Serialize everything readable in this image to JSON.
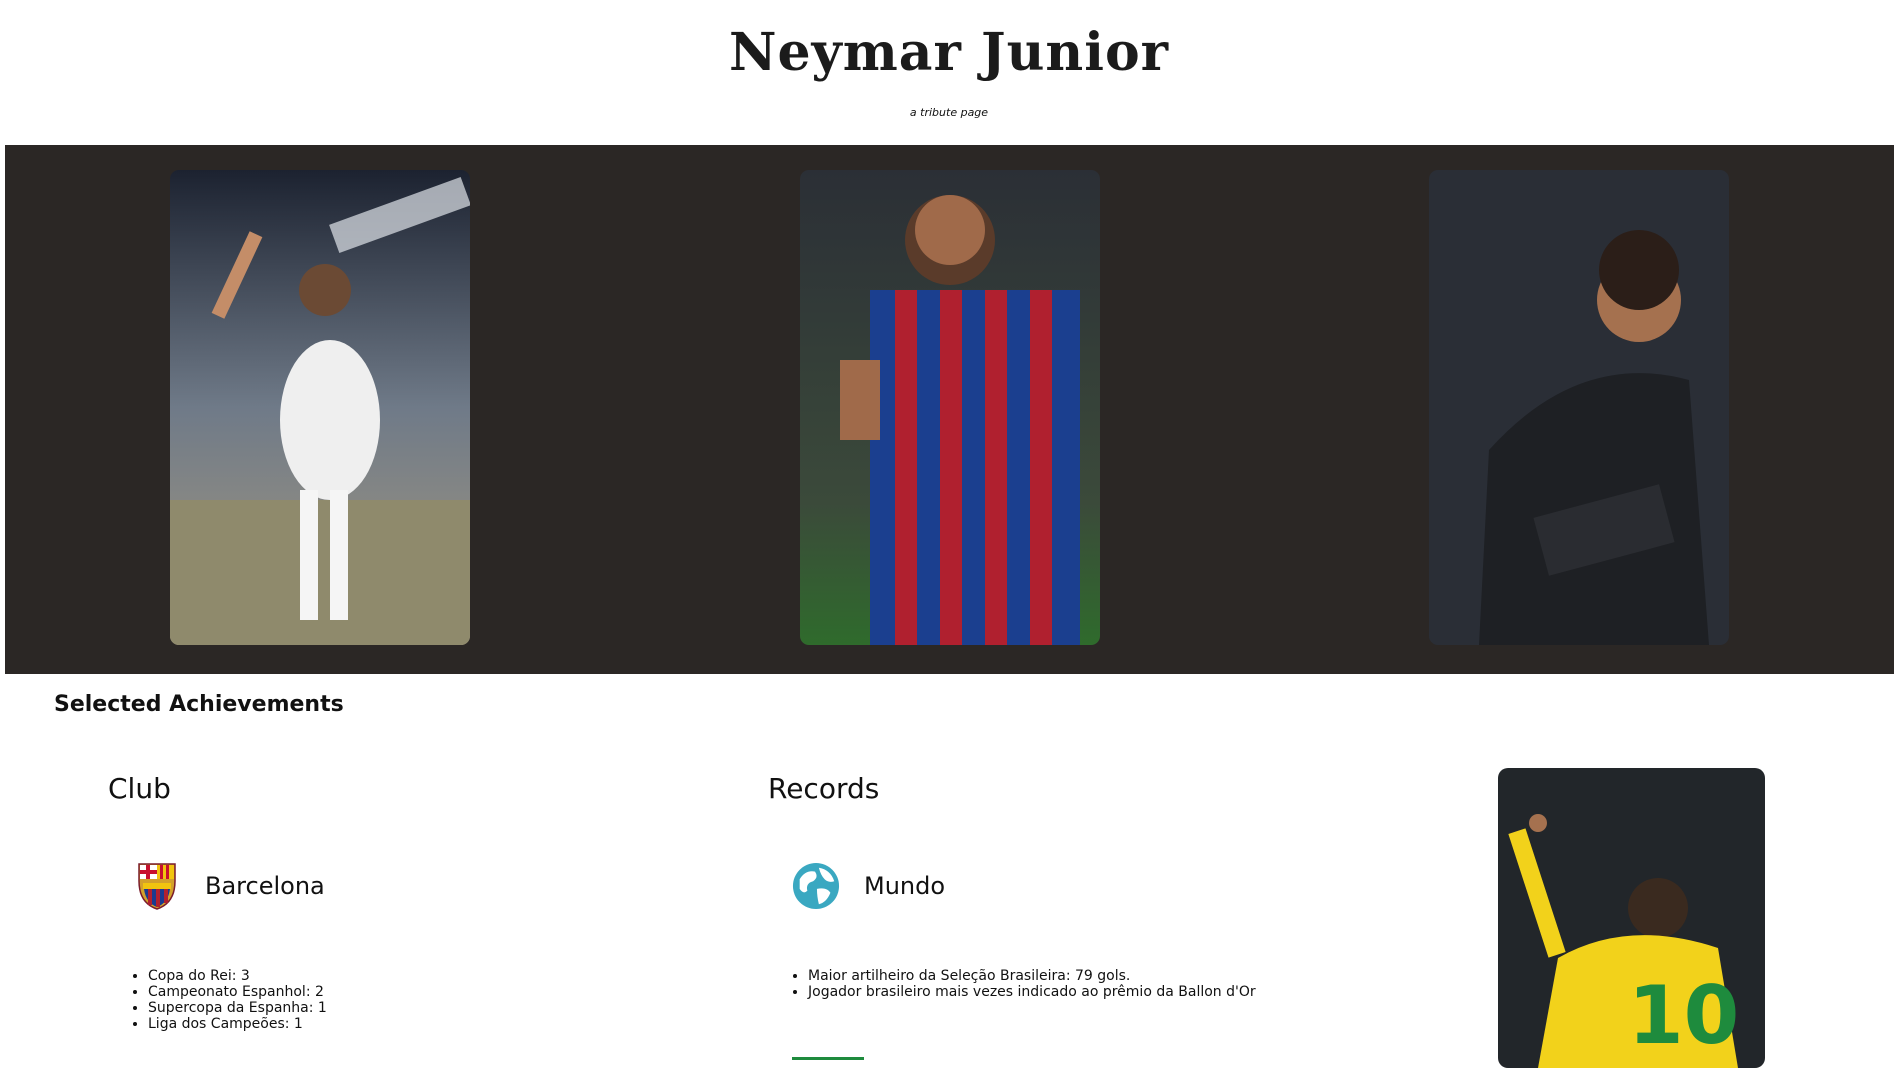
{
  "header": {
    "title": "Neymar Junior",
    "subtitle": "a tribute page"
  },
  "gallery": {
    "images": [
      {
        "icon": "santos-photo"
      },
      {
        "icon": "barcelona-photo"
      },
      {
        "icon": "psg-photo"
      }
    ],
    "background": "#2b2725"
  },
  "achievements": {
    "heading": "Selected Achievements",
    "club": {
      "title": "Club",
      "emblem_name": "Barcelona",
      "emblem_icon": "barcelona-crest-icon",
      "items": [
        "Copa do Rei: 3",
        "Campeonato Espanhol: 2",
        "Supercopa da Espanha: 1",
        "Liga dos Campeões: 1"
      ]
    },
    "records": {
      "title": "Records",
      "emblem_name": "Mundo",
      "emblem_icon": "globe-icon",
      "items": [
        "Maior artilheiro da Seleção Brasileira: 79 gols.",
        "Jogador brasileiro mais vezes indicado ao prêmio da Ballon d'Or"
      ]
    },
    "side_image": {
      "icon": "brazil-photo"
    }
  },
  "colors": {
    "accent_green": "#1e8b3d",
    "dark_band": "#2b2725"
  }
}
